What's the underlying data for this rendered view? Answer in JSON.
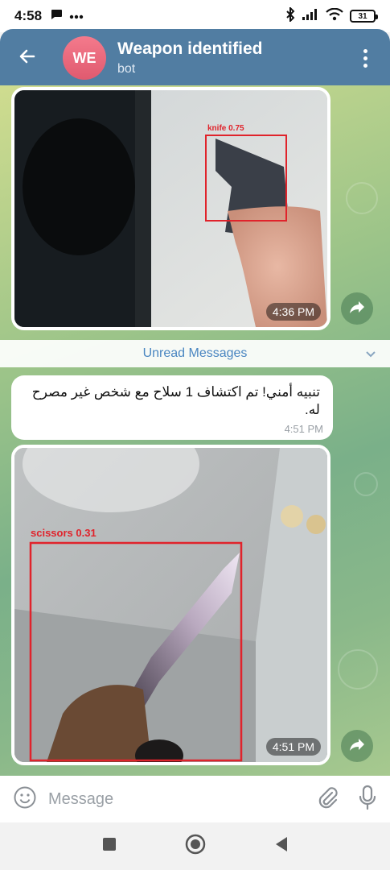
{
  "status_bar": {
    "time": "4:58",
    "battery": "31"
  },
  "header": {
    "avatar_initials": "WE",
    "title": "Weapon identified",
    "subtitle": "bot",
    "accent": "#517da2"
  },
  "messages": {
    "photo1": {
      "label": "knife 0.75",
      "time": "4:36 PM"
    },
    "unread_label": "Unread Messages",
    "text": {
      "body": "تنبيه أمني! تم اكتشاف 1 سلاح مع شخص غير مصرح له.",
      "time": "4:51 PM"
    },
    "photo2": {
      "label": "scissors 0.31",
      "time": "4:51 PM"
    }
  },
  "composer": {
    "placeholder": "Message"
  },
  "icons": [
    "back-arrow-icon",
    "more-vertical-icon",
    "share-icon",
    "chevron-down-icon",
    "emoji-icon",
    "attach-icon",
    "mic-icon",
    "square-icon",
    "circle-icon",
    "triangle-icon"
  ]
}
